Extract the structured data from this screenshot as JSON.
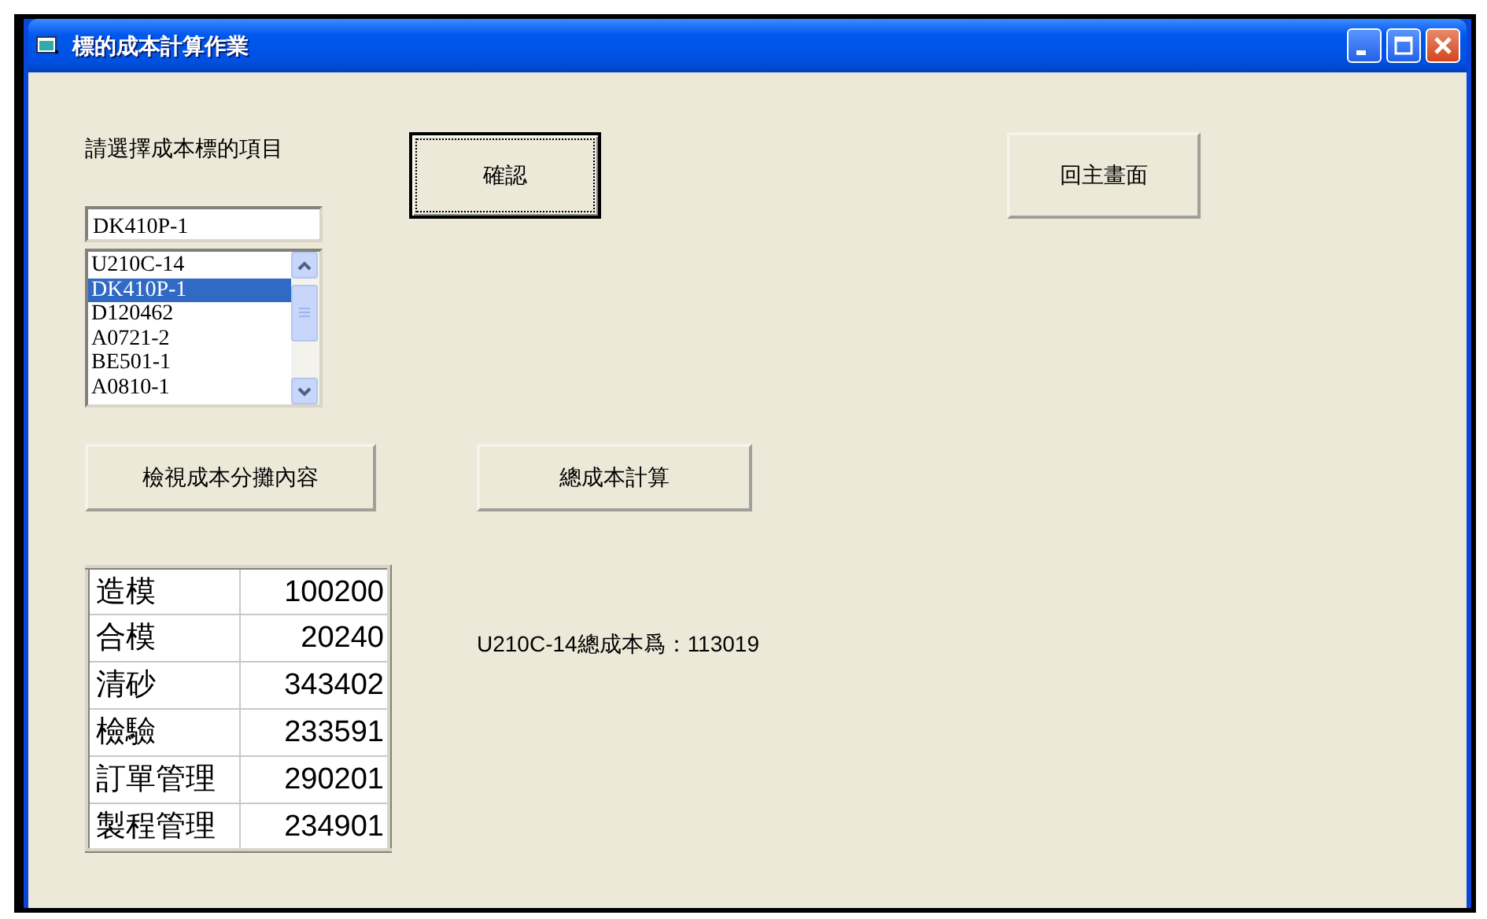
{
  "window": {
    "title": "標的成本計算作業"
  },
  "prompt_label": "請選擇成本標的項目",
  "combo": {
    "value": "DK410P-1"
  },
  "listbox": {
    "items": [
      {
        "label": "U210C-14",
        "selected": false
      },
      {
        "label": "DK410P-1",
        "selected": true
      },
      {
        "label": "D120462",
        "selected": false
      },
      {
        "label": "A0721-2",
        "selected": false
      },
      {
        "label": "BE501-1",
        "selected": false
      },
      {
        "label": "A0810-1",
        "selected": false
      }
    ]
  },
  "confirm_button": {
    "label": "確認",
    "focused": true
  },
  "home_button": {
    "label": "回主畫面",
    "focused": false
  },
  "view_button": {
    "label": "檢視成本分攤內容",
    "focused": false
  },
  "total_button": {
    "label": "總成本計算",
    "focused": false
  },
  "cost_table": {
    "rows": [
      {
        "item": "造模",
        "amount": "100200"
      },
      {
        "item": "合模",
        "amount": "20240"
      },
      {
        "item": "清砂",
        "amount": "343402"
      },
      {
        "item": "檢驗",
        "amount": "233591"
      },
      {
        "item": "訂單管理",
        "amount": "290201"
      },
      {
        "item": "製程管理",
        "amount": "234901"
      }
    ]
  },
  "result_text": "U210C-14總成本爲：113019"
}
